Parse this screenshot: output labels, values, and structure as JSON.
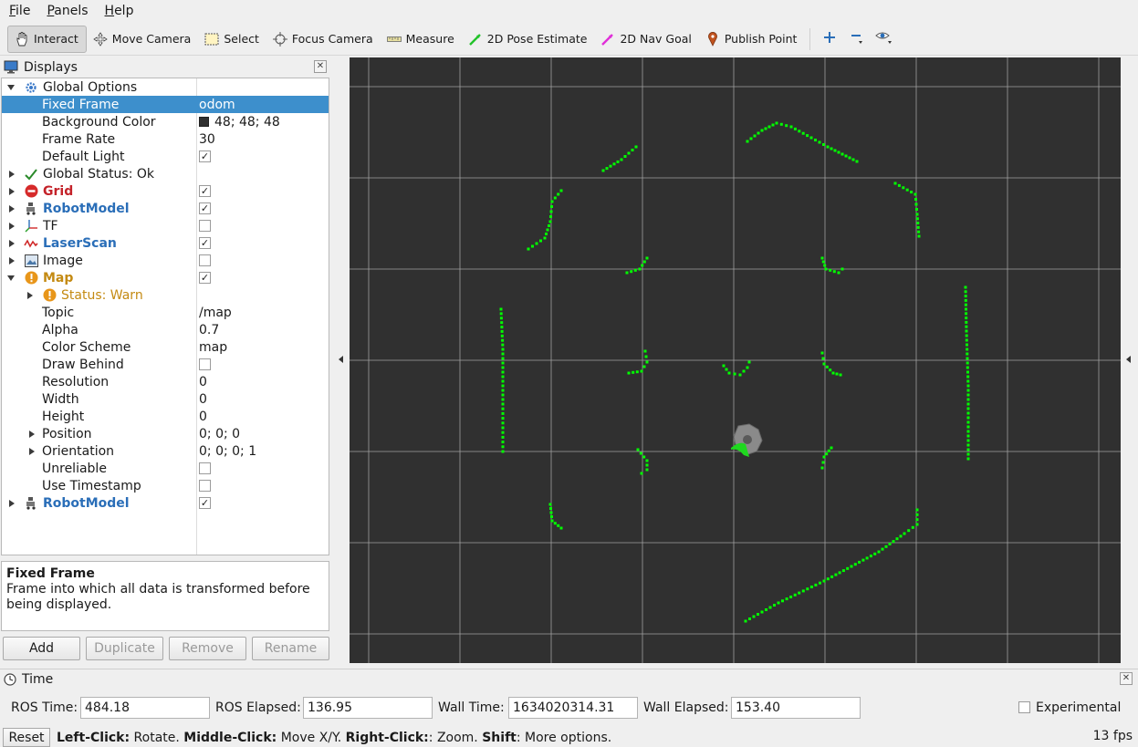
{
  "menu": [
    "File",
    "Panels",
    "Help"
  ],
  "toolbar": {
    "interact": "Interact",
    "move_camera": "Move Camera",
    "select": "Select",
    "focus_camera": "Focus Camera",
    "measure": "Measure",
    "pose_estimate": "2D Pose Estimate",
    "nav_goal": "2D Nav Goal",
    "publish_point": "Publish Point"
  },
  "displays": {
    "title": "Displays",
    "global_options": "Global Options",
    "fixed_frame_label": "Fixed Frame",
    "fixed_frame_value": "odom",
    "background_color_label": "Background Color",
    "background_color_value": "48; 48; 48",
    "frame_rate_label": "Frame Rate",
    "frame_rate_value": "30",
    "default_light_label": "Default Light",
    "global_status": "Global Status: Ok",
    "grid": "Grid",
    "robot_model": "RobotModel",
    "tf": "TF",
    "laser_scan": "LaserScan",
    "image": "Image",
    "map": "Map",
    "map_status": "Status: Warn",
    "topic_label": "Topic",
    "topic_value": "/map",
    "alpha_label": "Alpha",
    "alpha_value": "0.7",
    "color_scheme_label": "Color Scheme",
    "color_scheme_value": "map",
    "draw_behind_label": "Draw Behind",
    "resolution_label": "Resolution",
    "resolution_value": "0",
    "width_label": "Width",
    "width_value": "0",
    "height_label": "Height",
    "height_value": "0",
    "position_label": "Position",
    "position_value": "0; 0; 0",
    "orientation_label": "Orientation",
    "orientation_value": "0; 0; 0; 1",
    "unreliable_label": "Unreliable",
    "use_timestamp_label": "Use Timestamp",
    "robot_model_2": "RobotModel",
    "checks": {
      "default_light": true,
      "grid": true,
      "robot_model": true,
      "tf": false,
      "laser_scan": true,
      "image": false,
      "map": true,
      "draw_behind": false,
      "unreliable": false,
      "use_timestamp": false,
      "robot_model_2": true
    }
  },
  "description": {
    "title": "Fixed Frame",
    "text": "Frame into which all data is transformed before being displayed."
  },
  "buttons": {
    "add": "Add",
    "duplicate": "Duplicate",
    "remove": "Remove",
    "rename": "Rename"
  },
  "time": {
    "title": "Time",
    "ros_time_label": "ROS Time:",
    "ros_time_value": "484.18",
    "ros_elapsed_label": "ROS Elapsed:",
    "ros_elapsed_value": "136.95",
    "wall_time_label": "Wall Time:",
    "wall_time_value": "1634020314.31",
    "wall_elapsed_label": "Wall Elapsed:",
    "wall_elapsed_value": "153.40",
    "experimental_label": "Experimental"
  },
  "status": {
    "reset": "Reset",
    "left_click": "Left-Click:",
    "left_click_action": " Rotate. ",
    "middle_click": "Middle-Click:",
    "middle_click_action": " Move X/Y. ",
    "right_click": "Right-Click:",
    "right_click_action": ": Zoom. ",
    "shift": "Shift",
    "shift_action": ": More options.",
    "fps": "13 fps"
  },
  "colors": {
    "background": "#303030",
    "grid": "#a0a0a0",
    "laser": "#00ff00",
    "selection": "#3d8fcc"
  }
}
